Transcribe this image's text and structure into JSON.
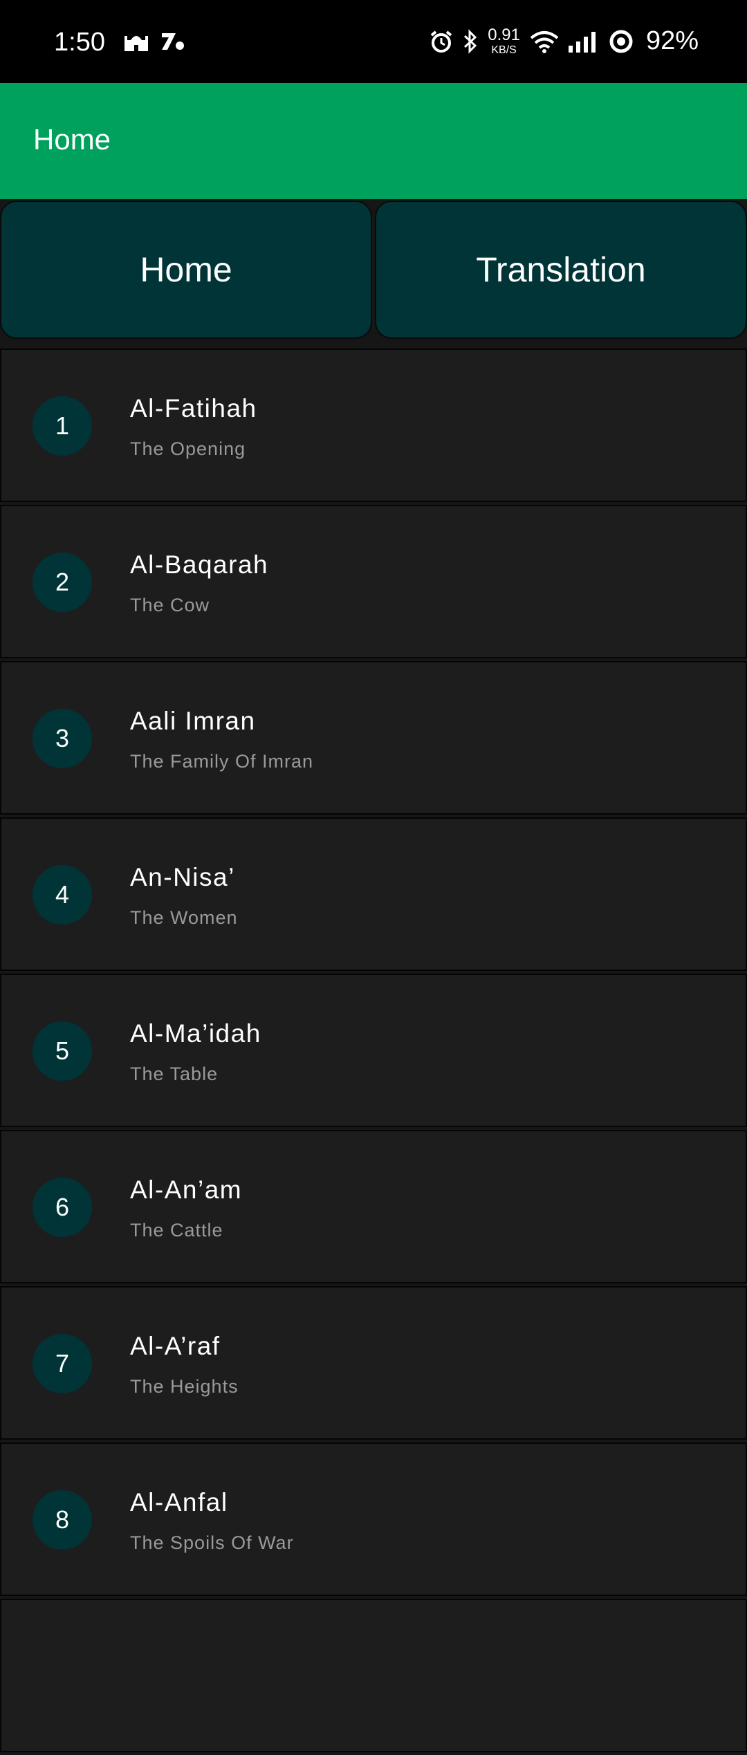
{
  "status_bar": {
    "time": "1:50",
    "net_speed_value": "0.91",
    "net_speed_unit": "KB/S",
    "battery": "92%",
    "icons": [
      "mosque-icon",
      "app-icon",
      "alarm-icon",
      "bluetooth-icon",
      "wifi-icon",
      "signal-icon",
      "battery-ring-icon"
    ]
  },
  "app_bar": {
    "title": "Home"
  },
  "tabs": [
    {
      "label": "Home"
    },
    {
      "label": "Translation"
    }
  ],
  "surahs": [
    {
      "number": "1",
      "name": "Al-Fatihah",
      "meaning": "The Opening"
    },
    {
      "number": "2",
      "name": "Al-Baqarah",
      "meaning": "The Cow"
    },
    {
      "number": "3",
      "name": "Aali Imran",
      "meaning": "The Family Of Imran"
    },
    {
      "number": "4",
      "name": "An-Nisa’",
      "meaning": "The Women"
    },
    {
      "number": "5",
      "name": "Al-Ma’idah",
      "meaning": "The Table"
    },
    {
      "number": "6",
      "name": "Al-An’am",
      "meaning": "The Cattle"
    },
    {
      "number": "7",
      "name": "Al-A’raf",
      "meaning": "The Heights"
    },
    {
      "number": "8",
      "name": "Al-Anfal",
      "meaning": "The Spoils Of War"
    }
  ],
  "colors": {
    "app_bar": "#00A05D",
    "tab_bg": "#003436",
    "badge_bg": "#003436",
    "row_bg": "#1D1D1E",
    "subtitle": "#9A9A9A"
  }
}
